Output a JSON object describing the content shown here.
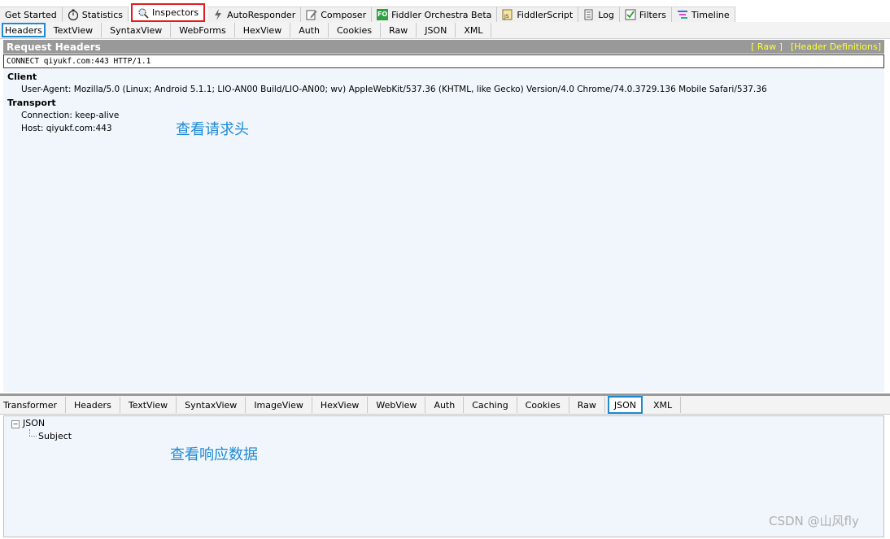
{
  "top_tabs": [
    {
      "label": "Get Started",
      "icon": "none"
    },
    {
      "label": "Statistics",
      "icon": "stopwatch-icon"
    },
    {
      "label": "Inspectors",
      "icon": "magnifier-icon",
      "active": true
    },
    {
      "label": "AutoResponder",
      "icon": "lightning-icon"
    },
    {
      "label": "Composer",
      "icon": "pencil-icon"
    },
    {
      "label": "Fiddler Orchestra Beta",
      "icon": "fo-icon",
      "icon_text": "FO"
    },
    {
      "label": "FiddlerScript",
      "icon": "script-icon"
    },
    {
      "label": "Log",
      "icon": "log-icon"
    },
    {
      "label": "Filters",
      "icon": "checkbox-icon"
    },
    {
      "label": "Timeline",
      "icon": "timeline-icon"
    }
  ],
  "request_tabs": [
    "Headers",
    "TextView",
    "SyntaxView",
    "WebForms",
    "HexView",
    "Auth",
    "Cookies",
    "Raw",
    "JSON",
    "XML"
  ],
  "request": {
    "title": "Request Headers",
    "link_raw": "[ Raw ]",
    "link_defs": "[Header Definitions]",
    "request_line": "CONNECT qiyukf.com:443 HTTP/1.1",
    "groups": [
      {
        "name": "Client",
        "headers": [
          "User-Agent: Mozilla/5.0 (Linux; Android 5.1.1; LIO-AN00 Build/LIO-AN00; wv) AppleWebKit/537.36 (KHTML, like Gecko) Version/4.0 Chrome/74.0.3729.136 Mobile Safari/537.36"
        ]
      },
      {
        "name": "Transport",
        "headers": [
          "Connection: keep-alive",
          "Host: qiyukf.com:443"
        ]
      }
    ],
    "annotation": "查看请求头"
  },
  "response_tabs": [
    "Transformer",
    "Headers",
    "TextView",
    "SyntaxView",
    "ImageView",
    "HexView",
    "WebView",
    "Auth",
    "Caching",
    "Cookies",
    "Raw",
    "JSON",
    "XML"
  ],
  "response": {
    "tree_root": "JSON",
    "tree_child": "Subject",
    "toggle_symbol": "−",
    "annotation": "查看响应数据"
  },
  "watermark": "CSDN @山风fly",
  "colors": {
    "active_tab_border": "#e01e1e",
    "selected_subtab_border": "#1e8ad6",
    "annotation": "#1e8ad6",
    "header_bar": "#999999",
    "header_links": "#ffff33"
  }
}
